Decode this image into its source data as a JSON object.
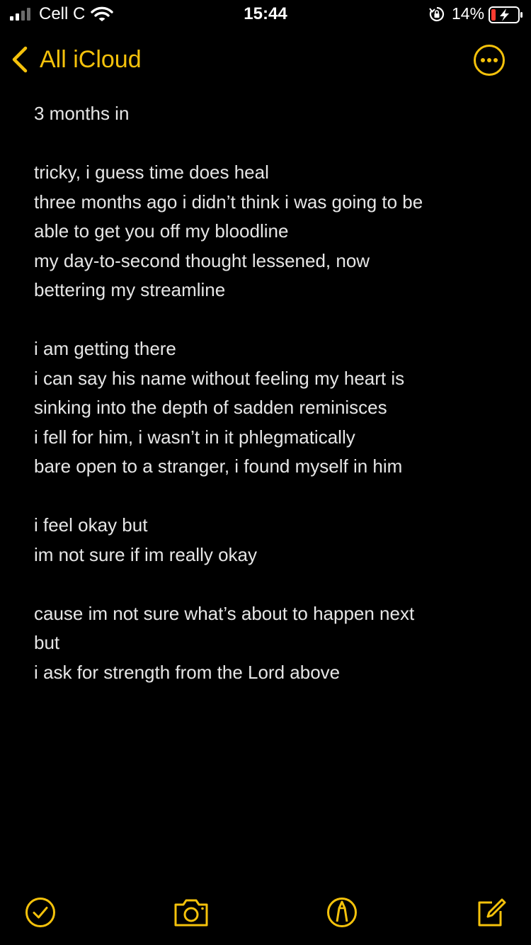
{
  "status_bar": {
    "carrier": "Cell C",
    "time": "15:44",
    "battery_percent": "14%"
  },
  "nav": {
    "back_label": "All iCloud",
    "accent_color": "#f5c20b"
  },
  "note": {
    "lines": [
      "3 months in",
      "",
      "tricky, i guess time does heal",
      "three months ago i didn’t think i was going to be",
      "able to get you off my bloodline",
      "my day-to-second thought lessened, now",
      "bettering my streamline",
      "",
      "i am getting there",
      "i can say his name without feeling my heart is",
      "sinking into the depth of sadden reminisces",
      "i fell for him, i wasn’t in it phlegmatically",
      "bare open to a stranger, i found myself in him",
      "",
      "i feel okay but",
      "im not sure if im really okay",
      "",
      "cause im not sure what’s about to happen next",
      "but",
      "i ask for strength from the Lord above"
    ]
  },
  "toolbar": {
    "icons": [
      "checklist-icon",
      "camera-icon",
      "markup-icon",
      "compose-icon"
    ]
  }
}
